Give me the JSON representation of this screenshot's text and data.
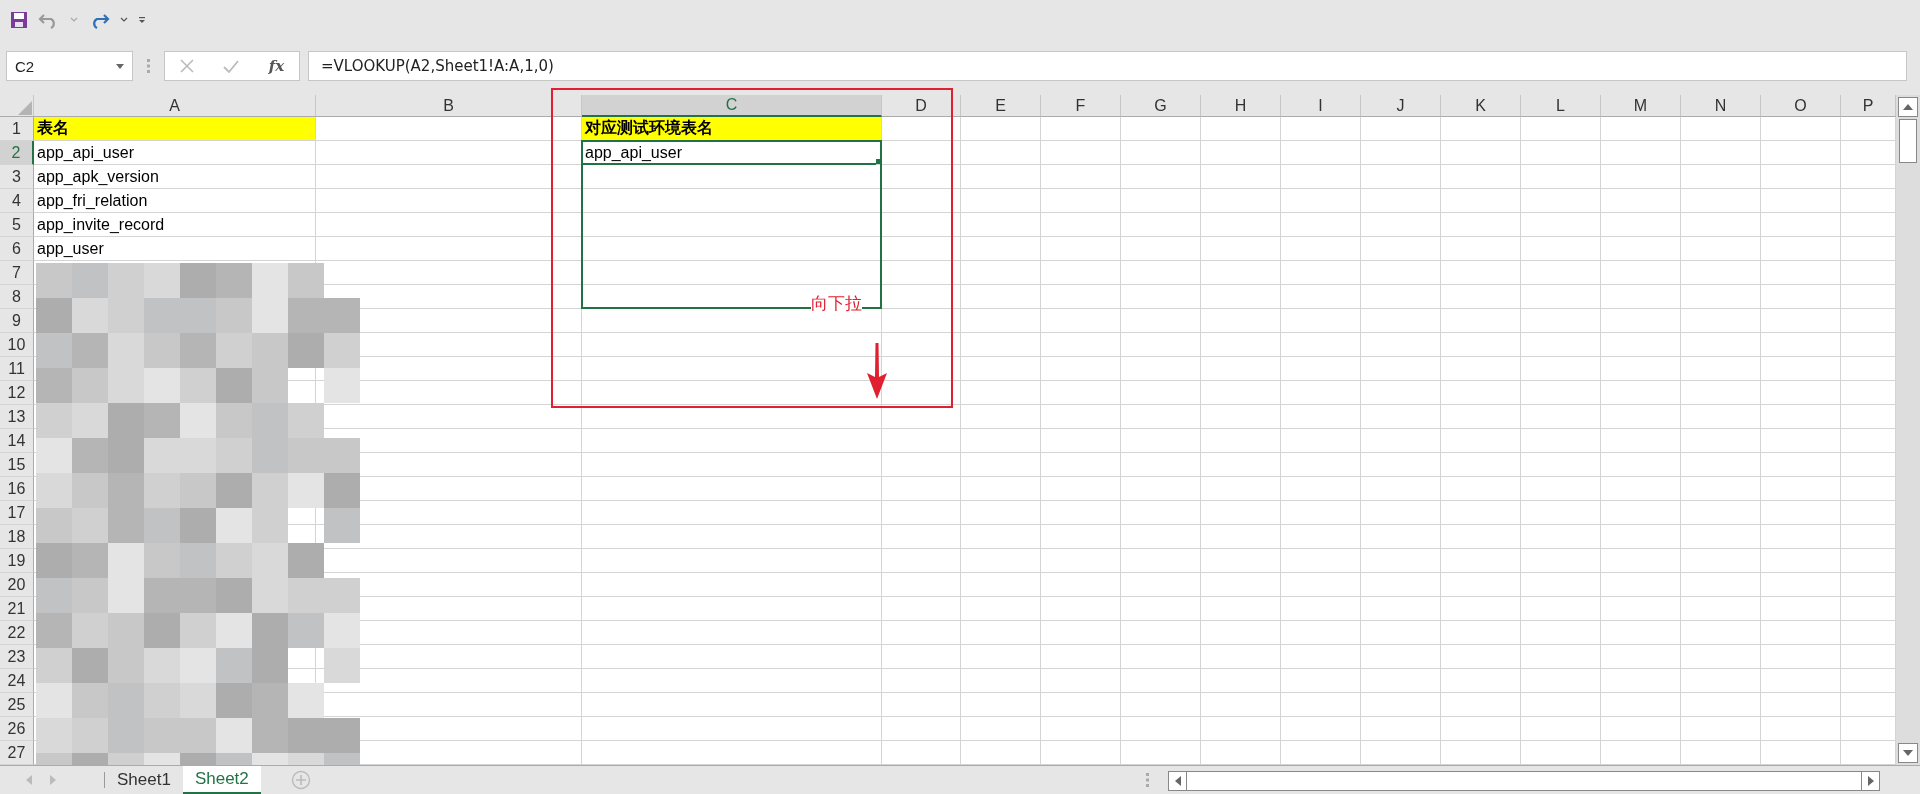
{
  "formula_bar": {
    "name_box": "C2",
    "function_button": "fx",
    "formula": "=VLOOKUP(A2,Sheet1!A:A,1,0)"
  },
  "columns": [
    {
      "label": "A",
      "selected": false
    },
    {
      "label": "B",
      "selected": false
    },
    {
      "label": "C",
      "selected": true
    },
    {
      "label": "D",
      "selected": false
    },
    {
      "label": "E",
      "selected": false
    },
    {
      "label": "F",
      "selected": false
    },
    {
      "label": "G",
      "selected": false
    },
    {
      "label": "H",
      "selected": false
    },
    {
      "label": "I",
      "selected": false
    },
    {
      "label": "J",
      "selected": false
    },
    {
      "label": "K",
      "selected": false
    },
    {
      "label": "L",
      "selected": false
    },
    {
      "label": "M",
      "selected": false
    },
    {
      "label": "N",
      "selected": false
    },
    {
      "label": "O",
      "selected": false
    },
    {
      "label": "P",
      "selected": false
    }
  ],
  "rows": [
    {
      "label": "1",
      "selected": false,
      "in_selection": false,
      "A": {
        "text": "表名",
        "color": "#ffff00",
        "bold": true
      },
      "C": {
        "text": "对应测试环境表名",
        "color": "#ffff00",
        "bold": true
      }
    },
    {
      "label": "2",
      "selected": true,
      "in_selection": true,
      "A": {
        "text": "app_api_user"
      },
      "C": {
        "text": "app_api_user"
      }
    },
    {
      "label": "3",
      "selected": false,
      "in_selection": true,
      "A": {
        "text": "app_apk_version"
      }
    },
    {
      "label": "4",
      "selected": false,
      "in_selection": true,
      "A": {
        "text": "app_fri_relation"
      }
    },
    {
      "label": "5",
      "selected": false,
      "in_selection": true,
      "A": {
        "text": "app_invite_record"
      }
    },
    {
      "label": "6",
      "selected": false,
      "in_selection": true,
      "A": {
        "text": "app_user"
      }
    },
    {
      "label": "7",
      "selected": false,
      "in_selection": true
    },
    {
      "label": "8",
      "selected": false,
      "in_selection": true
    },
    {
      "label": "9",
      "selected": false,
      "in_selection": false
    },
    {
      "label": "10",
      "selected": false,
      "in_selection": false
    },
    {
      "label": "11",
      "selected": false,
      "in_selection": false
    },
    {
      "label": "12",
      "selected": false,
      "in_selection": false
    },
    {
      "label": "13",
      "selected": false,
      "in_selection": false
    },
    {
      "label": "14",
      "selected": false,
      "in_selection": false
    },
    {
      "label": "15",
      "selected": false,
      "in_selection": false
    },
    {
      "label": "16",
      "selected": false,
      "in_selection": false
    },
    {
      "label": "17",
      "selected": false,
      "in_selection": false
    },
    {
      "label": "18",
      "selected": false,
      "in_selection": false
    },
    {
      "label": "19",
      "selected": false,
      "in_selection": false
    },
    {
      "label": "20",
      "selected": false,
      "in_selection": false
    },
    {
      "label": "21",
      "selected": false,
      "in_selection": false
    },
    {
      "label": "22",
      "selected": false,
      "in_selection": false
    },
    {
      "label": "23",
      "selected": false,
      "in_selection": false
    },
    {
      "label": "24",
      "selected": false,
      "in_selection": false
    },
    {
      "label": "25",
      "selected": false,
      "in_selection": false
    },
    {
      "label": "26",
      "selected": false,
      "in_selection": false
    },
    {
      "label": "27",
      "selected": false,
      "in_selection": false
    }
  ],
  "annotation": {
    "label": "向下拉"
  },
  "sheet_tabs": [
    {
      "label": "Sheet1",
      "selected": false
    },
    {
      "label": "Sheet2",
      "selected": true
    }
  ]
}
